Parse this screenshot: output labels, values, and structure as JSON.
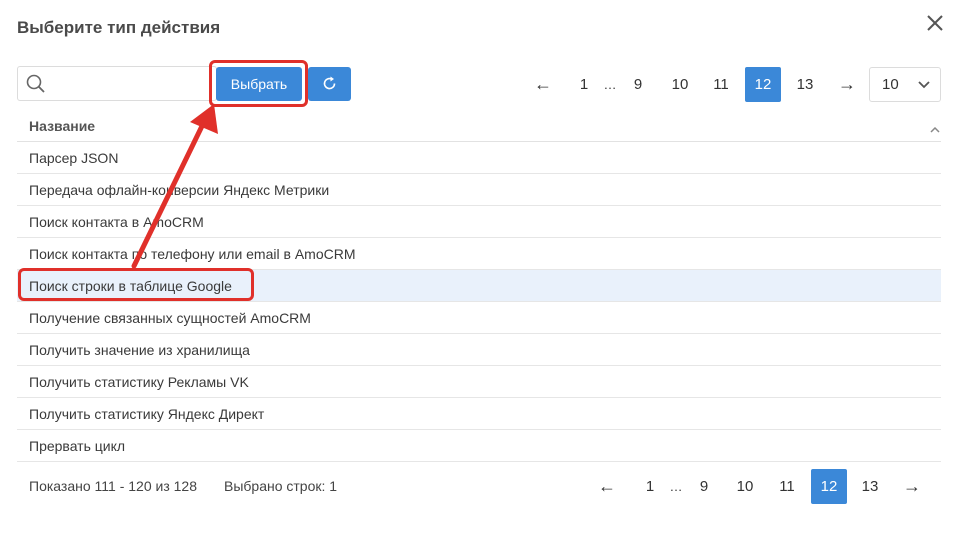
{
  "dialog": {
    "title": "Выберите тип действия"
  },
  "search": {
    "value": "",
    "placeholder": ""
  },
  "toolbar": {
    "select_label": "Выбрать"
  },
  "pagination_top": {
    "prev": "←",
    "pages": [
      "1",
      "…",
      "9",
      "10",
      "11",
      "12",
      "13"
    ],
    "active": "12",
    "next": "→"
  },
  "per_page": {
    "value": "10"
  },
  "table": {
    "column_header": "Название",
    "rows": [
      "Парсер JSON",
      "Передача офлайн-конверсии Яндекс Метрики",
      "Поиск контакта в AmoCRM",
      "Поиск контакта по телефону или email в AmoCRM",
      "Поиск строки в таблице Google",
      "Получение связанных сущностей AmoCRM",
      "Получить значение из хранилища",
      "Получить статистику Рекламы VK",
      "Получить статистику Яндекс Директ",
      "Прервать цикл"
    ],
    "selected_index": 4
  },
  "footer": {
    "shown": "Показано 111 - 120 из 128",
    "selected_rows": "Выбрано строк: 1"
  },
  "pagination_bottom": {
    "prev": "←",
    "pages": [
      "1",
      "…",
      "9",
      "10",
      "11",
      "12",
      "13"
    ],
    "active": "12",
    "next": "→"
  },
  "colors": {
    "accent": "#3b88d8",
    "highlight": "#e0302a",
    "selected_row": "#e9f1fb"
  }
}
